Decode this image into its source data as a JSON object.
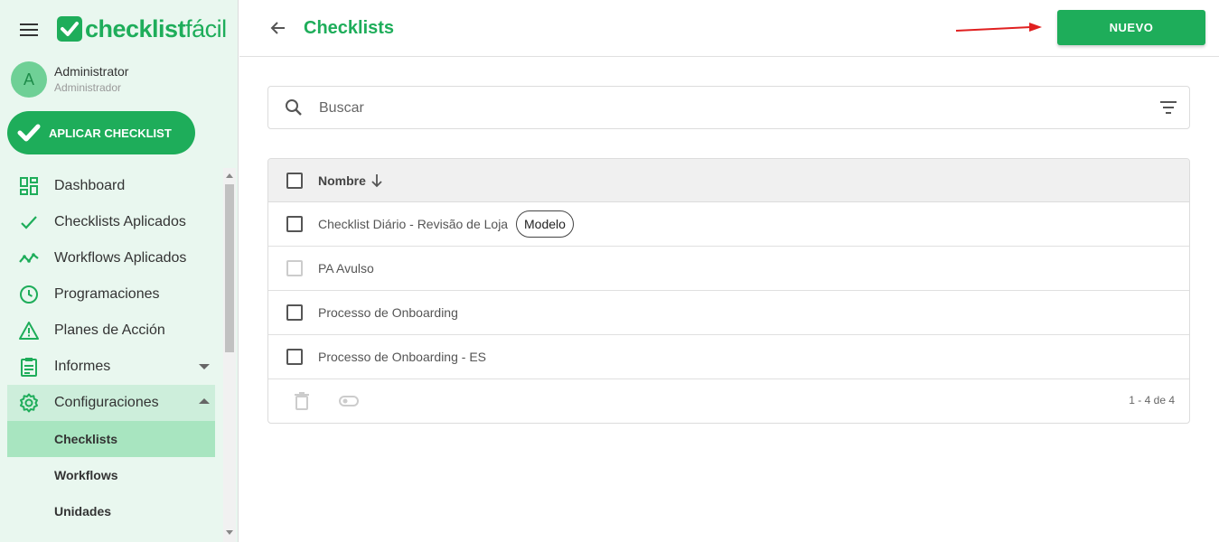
{
  "brand": {
    "logo_bold": "checklist",
    "logo_light": "fácil",
    "color": "#1ead5a"
  },
  "user": {
    "initial": "A",
    "name": "Administrator",
    "role": "Administrador"
  },
  "apply_button": {
    "label": "APLICAR CHECKLIST"
  },
  "nav": {
    "items": [
      {
        "label": "Dashboard",
        "icon": "dashboard-icon"
      },
      {
        "label": "Checklists Aplicados",
        "icon": "check-icon"
      },
      {
        "label": "Workflows Aplicados",
        "icon": "trending-icon"
      },
      {
        "label": "Programaciones",
        "icon": "clock-icon"
      },
      {
        "label": "Planes de Acción",
        "icon": "warning-icon"
      },
      {
        "label": "Informes",
        "icon": "clipboard-icon"
      },
      {
        "label": "Configuraciones",
        "icon": "gear-icon"
      }
    ],
    "sub_items": [
      {
        "label": "Checklists",
        "active": true
      },
      {
        "label": "Workflows",
        "active": false
      },
      {
        "label": "Unidades",
        "active": false
      }
    ]
  },
  "header": {
    "title": "Checklists",
    "new_button": "NUEVO"
  },
  "search": {
    "placeholder": "Buscar"
  },
  "table": {
    "column": "Nombre",
    "rows": [
      {
        "name": "Checklist Diário - Revisão de Loja",
        "badge": "Modelo"
      },
      {
        "name": "PA Avulso",
        "badge": ""
      },
      {
        "name": "Processo de Onboarding",
        "badge": ""
      },
      {
        "name": "Processo de Onboarding - ES",
        "badge": ""
      }
    ],
    "pagination": "1 - 4 de 4"
  }
}
